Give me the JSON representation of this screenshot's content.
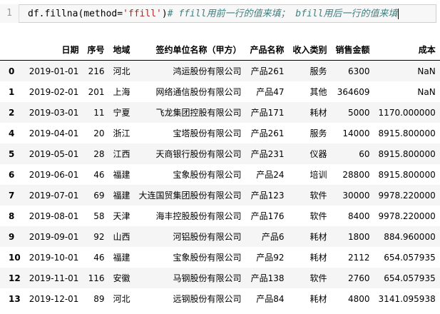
{
  "code_cell": {
    "line_number": "1",
    "code_prefix": "df.fillna(method=",
    "code_string": "'ffill'",
    "code_suffix": ")",
    "code_comment": "# ffill用前一行的值来填； bfill用后一行的值来填"
  },
  "table": {
    "columns": [
      "",
      "日期",
      "序号",
      "地域",
      "签约单位名称（甲方）",
      "产品名称",
      "收入类别",
      "销售金额",
      "成本"
    ],
    "rows": [
      {
        "index": "0",
        "date": "2019-01-01",
        "seq": "216",
        "region": "河北",
        "company": "鸿运股份有限公司",
        "product": "产品261",
        "category": "服务",
        "sales": "6300",
        "cost": "NaN"
      },
      {
        "index": "1",
        "date": "2019-02-01",
        "seq": "201",
        "region": "上海",
        "company": "网络通信股份有限公司",
        "product": "产品47",
        "category": "其他",
        "sales": "364609",
        "cost": "NaN"
      },
      {
        "index": "2",
        "date": "2019-03-01",
        "seq": "11",
        "region": "宁夏",
        "company": "飞龙集团控股有限公司",
        "product": "产品171",
        "category": "耗材",
        "sales": "5000",
        "cost": "1170.000000"
      },
      {
        "index": "4",
        "date": "2019-04-01",
        "seq": "20",
        "region": "浙江",
        "company": "宝塔股份有限公司",
        "product": "产品261",
        "category": "服务",
        "sales": "14000",
        "cost": "8915.800000"
      },
      {
        "index": "5",
        "date": "2019-05-01",
        "seq": "28",
        "region": "江西",
        "company": "天商银行股份有限公司",
        "product": "产品231",
        "category": "仪器",
        "sales": "60",
        "cost": "8915.800000"
      },
      {
        "index": "6",
        "date": "2019-06-01",
        "seq": "46",
        "region": "福建",
        "company": "宝象股份有限公司",
        "product": "产品24",
        "category": "培训",
        "sales": "28800",
        "cost": "8915.800000"
      },
      {
        "index": "7",
        "date": "2019-07-01",
        "seq": "69",
        "region": "福建",
        "company": "大连国贸集团股份有限公司",
        "product": "产品123",
        "category": "软件",
        "sales": "30000",
        "cost": "9978.220000"
      },
      {
        "index": "8",
        "date": "2019-08-01",
        "seq": "58",
        "region": "天津",
        "company": "海丰控股股份有限公司",
        "product": "产品176",
        "category": "软件",
        "sales": "8400",
        "cost": "9978.220000"
      },
      {
        "index": "9",
        "date": "2019-09-01",
        "seq": "92",
        "region": "山西",
        "company": "河铝股份有限公司",
        "product": "产品6",
        "category": "耗材",
        "sales": "1800",
        "cost": "884.960000"
      },
      {
        "index": "10",
        "date": "2019-10-01",
        "seq": "46",
        "region": "福建",
        "company": "宝象股份有限公司",
        "product": "产品92",
        "category": "耗材",
        "sales": "2112",
        "cost": "654.057935"
      },
      {
        "index": "12",
        "date": "2019-11-01",
        "seq": "116",
        "region": "安徽",
        "company": "马钢股份有限公司",
        "product": "产品138",
        "category": "软件",
        "sales": "2760",
        "cost": "654.057935"
      },
      {
        "index": "13",
        "date": "2019-12-01",
        "seq": "89",
        "region": "河北",
        "company": "远钢股份有限公司",
        "product": "产品84",
        "category": "耗材",
        "sales": "4800",
        "cost": "3141.095938"
      }
    ]
  }
}
